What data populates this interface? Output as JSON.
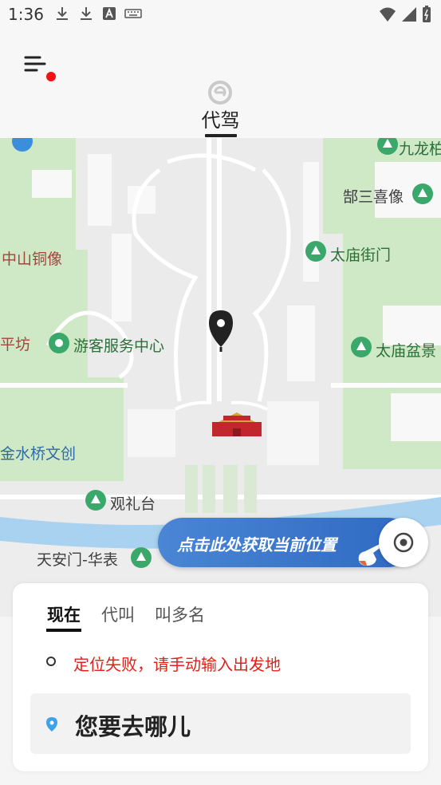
{
  "status_bar": {
    "time": "1:36"
  },
  "header": {
    "active_tab": "代驾"
  },
  "map": {
    "labels": {
      "jiulong": "九龙柏",
      "busanxi": "郜三喜像",
      "zhongshan": "中山铜像",
      "taimiao_jiemen": "太庙街门",
      "pingfang": "平坊",
      "visitor_center": "游客服务中心",
      "taimiao_penjing": "太庙盆景",
      "jinshuiqiao": "金水桥文创",
      "guanlitai": "观礼台",
      "tiananmen_huabiao": "天安门-华表"
    },
    "locate_prompt": "点击此处获取当前位置",
    "colors": {
      "green": "#cfe8c5",
      "water": "#a9d2f0",
      "accent": "#3a77cc",
      "error": "#e3201b"
    }
  },
  "card": {
    "tabs": [
      "现在",
      "代叫",
      "叫多名"
    ],
    "origin_error": "定位失败，请手动输入出发地",
    "destination_placeholder": "您要去哪儿"
  }
}
